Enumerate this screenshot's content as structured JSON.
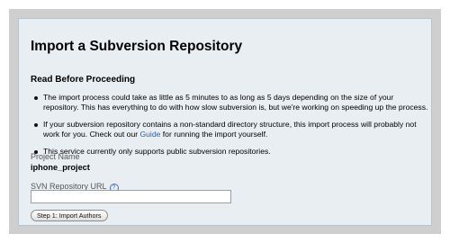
{
  "page": {
    "title": "Import a Subversion Repository",
    "subheading": "Read Before Proceeding"
  },
  "notes": {
    "item1": "The import process could take as little as 5 minutes to as long as 5 days depending on the size of your repository. This has everything to do with how slow subversion is, but we're working on speeding up the process.",
    "item2_before": "If your subversion repository contains a non-standard directory structure, this import process will probably not work for you. Check out our ",
    "item2_link": "Guide",
    "item2_after": " for running the import yourself.",
    "item3": "This service currently only supports public subversion repositories."
  },
  "form": {
    "project_name_label": "Project Name",
    "project_name_value": "iphone_project",
    "svn_url_label": "SVN Repository URL",
    "svn_url_value": "",
    "help_icon": "question-circle-icon",
    "help_glyph": "?",
    "submit_label": "Step 1: Import Authors"
  },
  "colors": {
    "panel_background": "#e9eef2",
    "frame": "#cfcfcf",
    "link": "#2b5fa8"
  }
}
